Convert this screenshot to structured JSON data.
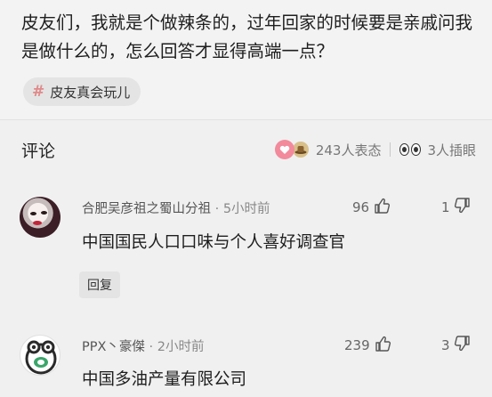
{
  "post": {
    "text": "皮友们，我就是个做辣条的，过年回家的时候要是亲戚问我是做什么的，怎么回答才显得高端一点？",
    "tag_icon": "#",
    "tag_label": "皮友真会玩儿"
  },
  "comments_section": {
    "title": "评论",
    "reactions_count": "243人表态",
    "eyes_count": "3人插眼",
    "icons": [
      "heart-icon",
      "hat-icon",
      "eyes-icon"
    ]
  },
  "comments": [
    {
      "author": "合肥吴彦祖之蜀山分祖",
      "separator": "·",
      "time": "5小时前",
      "likes": "96",
      "dislikes": "1",
      "text": "中国国民人口口味与个人喜好调查官",
      "reply_label": "回复"
    },
    {
      "author": "PPX丶豪傑",
      "separator": "·",
      "time": "2小时前",
      "likes": "239",
      "dislikes": "3",
      "text": "中国多油产量有限公司"
    }
  ],
  "colors": {
    "background": "#f0f0f0",
    "tag_background": "#e4e4e4",
    "tag_hash": "#e08a8a",
    "heart_badge": "#f28a9c"
  }
}
